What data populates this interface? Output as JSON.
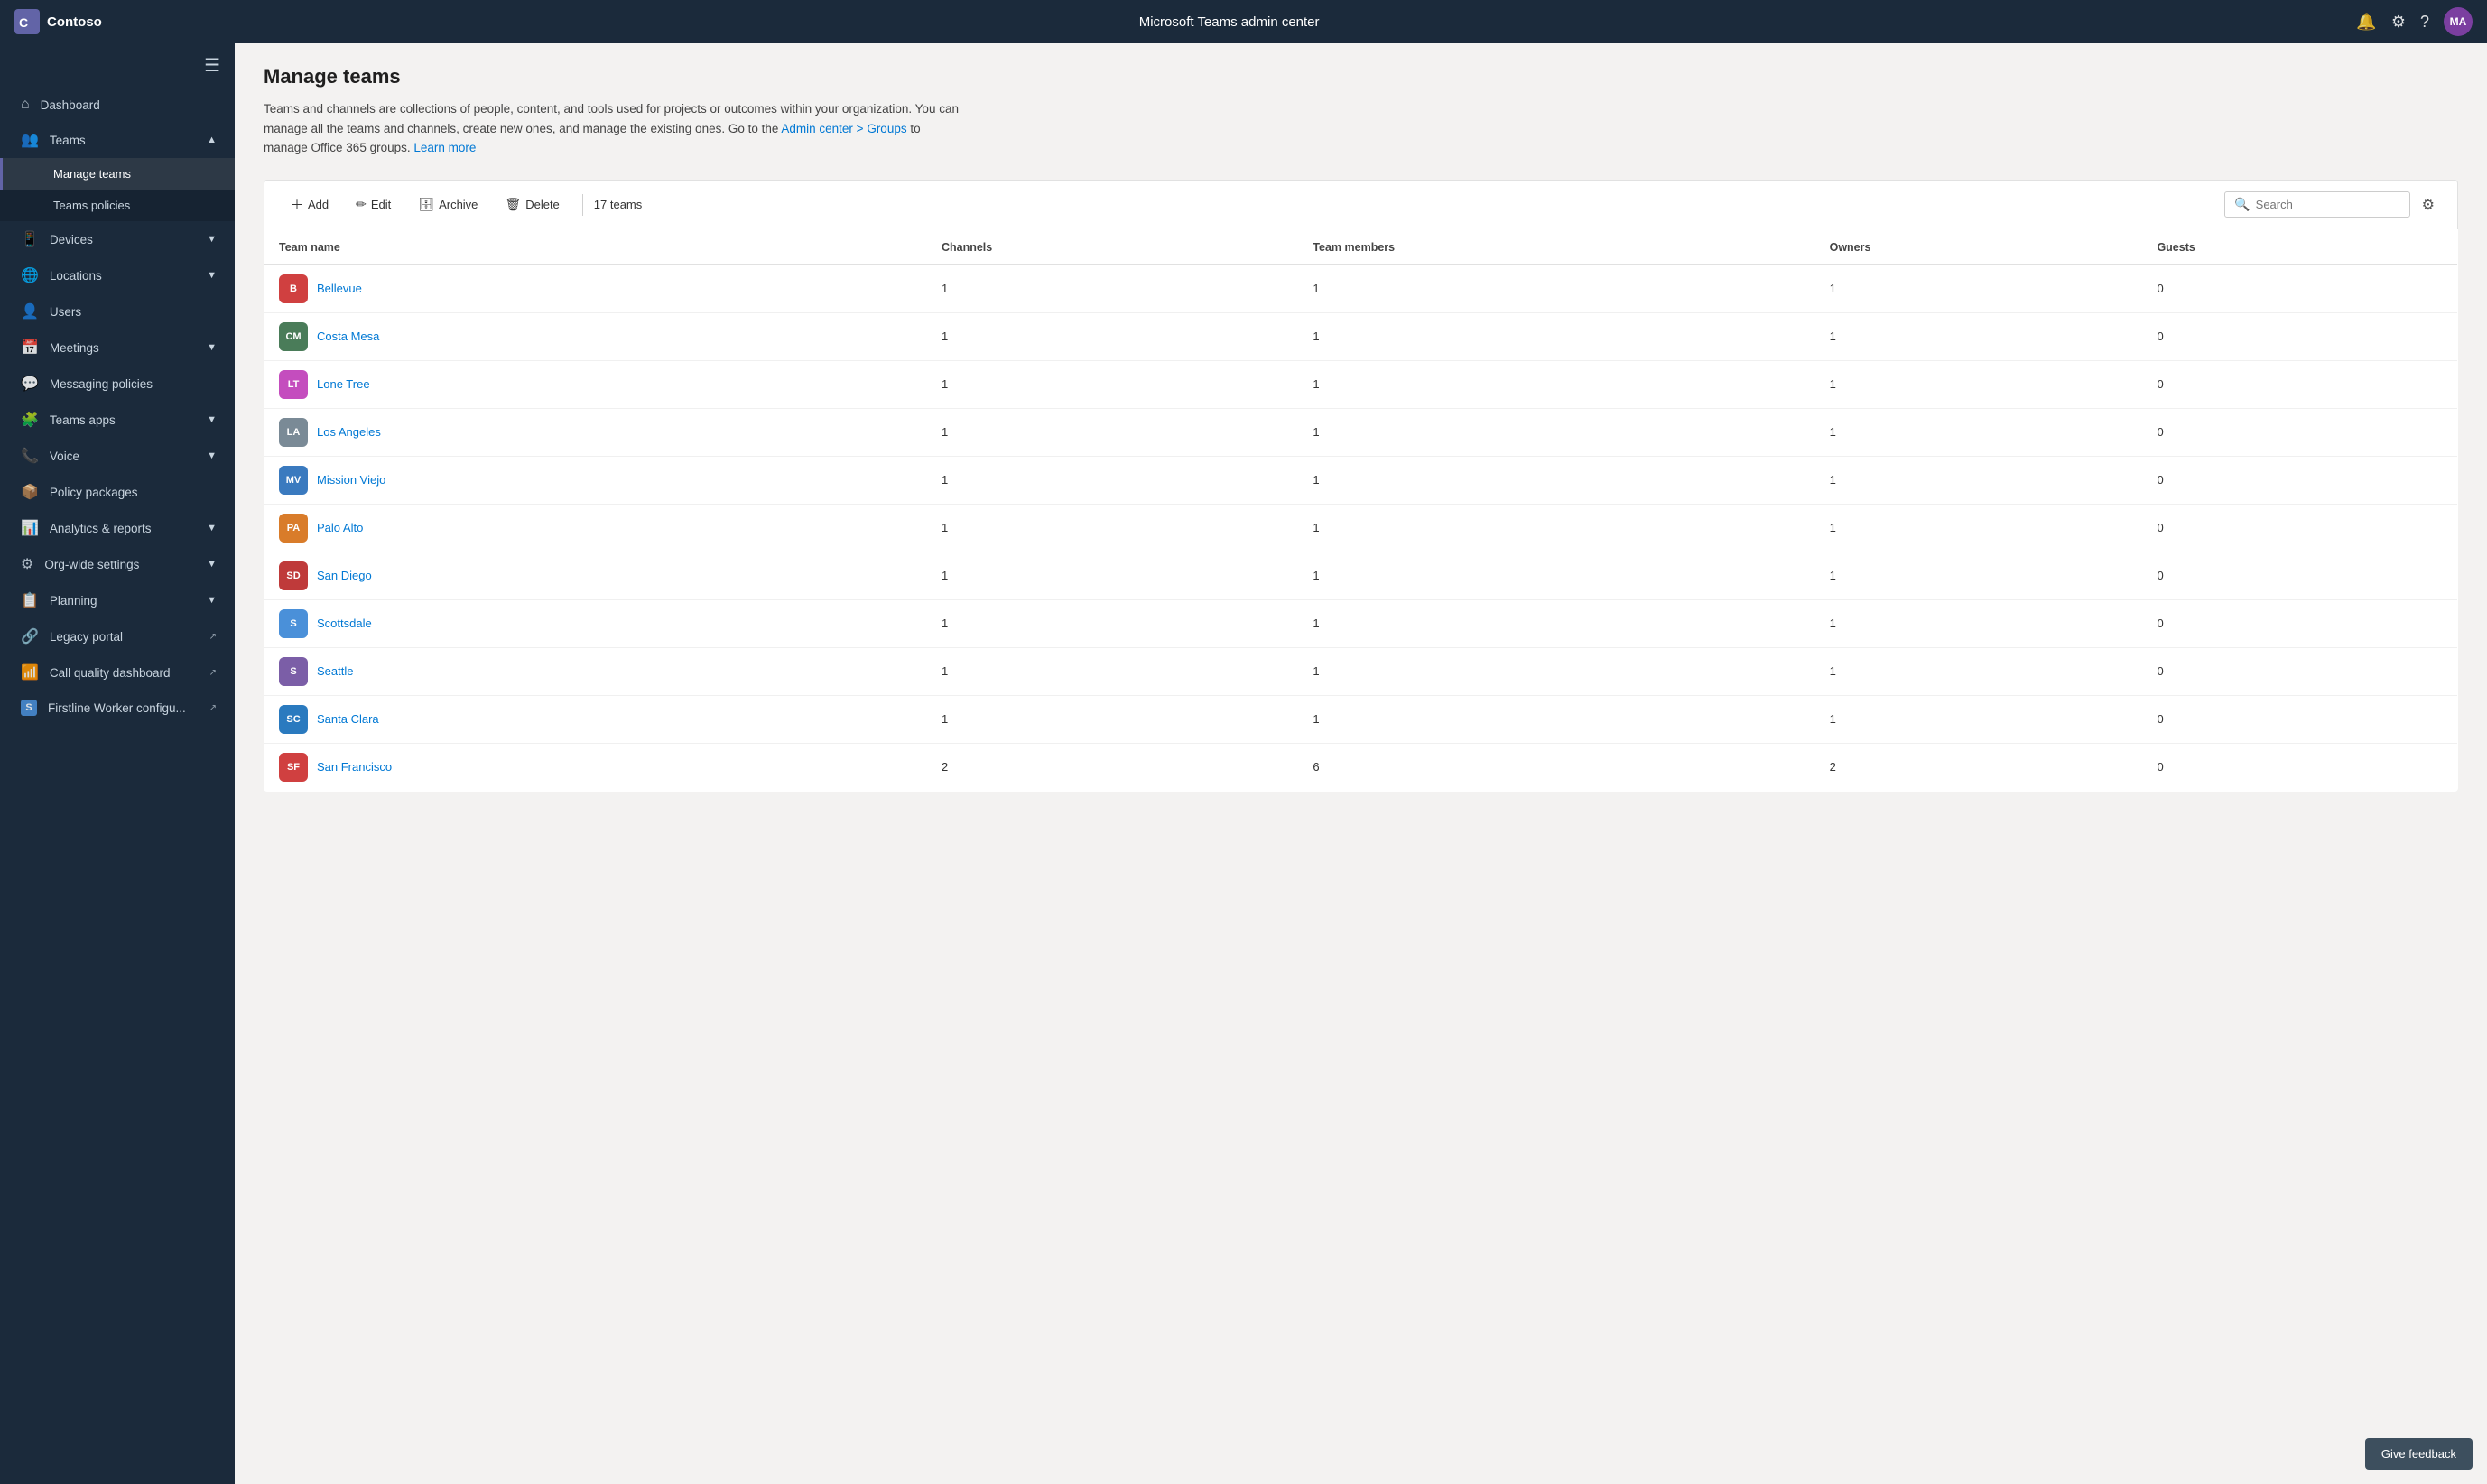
{
  "topbar": {
    "logo_text": "Contoso",
    "title": "Microsoft Teams admin center",
    "avatar_initials": "MA",
    "notification_icon": "🔔",
    "settings_icon": "⚙",
    "help_icon": "?"
  },
  "sidebar": {
    "hamburger": "☰",
    "items": [
      {
        "id": "dashboard",
        "label": "Dashboard",
        "icon": "⌂",
        "hasChildren": false
      },
      {
        "id": "teams",
        "label": "Teams",
        "icon": "👥",
        "hasChildren": true,
        "expanded": true
      },
      {
        "id": "manage-teams",
        "label": "Manage teams",
        "icon": "",
        "isChild": true,
        "active": true
      },
      {
        "id": "teams-policies",
        "label": "Teams policies",
        "icon": "",
        "isChild": true
      },
      {
        "id": "devices",
        "label": "Devices",
        "icon": "📱",
        "hasChildren": true
      },
      {
        "id": "locations",
        "label": "Locations",
        "icon": "🌐",
        "hasChildren": true
      },
      {
        "id": "users",
        "label": "Users",
        "icon": "👤",
        "hasChildren": false
      },
      {
        "id": "meetings",
        "label": "Meetings",
        "icon": "📅",
        "hasChildren": true
      },
      {
        "id": "messaging-policies",
        "label": "Messaging policies",
        "icon": "💬",
        "hasChildren": false
      },
      {
        "id": "teams-apps",
        "label": "Teams apps",
        "icon": "🧩",
        "hasChildren": true
      },
      {
        "id": "voice",
        "label": "Voice",
        "icon": "📞",
        "hasChildren": true
      },
      {
        "id": "policy-packages",
        "label": "Policy packages",
        "icon": "📦",
        "hasChildren": false
      },
      {
        "id": "analytics-reports",
        "label": "Analytics & reports",
        "icon": "📊",
        "hasChildren": true
      },
      {
        "id": "org-wide-settings",
        "label": "Org-wide settings",
        "icon": "⚙",
        "hasChildren": true
      },
      {
        "id": "planning",
        "label": "Planning",
        "icon": "📋",
        "hasChildren": true
      },
      {
        "id": "legacy-portal",
        "label": "Legacy portal",
        "icon": "🔗",
        "hasChildren": false,
        "external": true
      },
      {
        "id": "call-quality",
        "label": "Call quality dashboard",
        "icon": "📶",
        "hasChildren": false,
        "external": true
      },
      {
        "id": "firstline-worker",
        "label": "Firstline Worker configu...",
        "icon": "S",
        "hasChildren": false,
        "external": true
      }
    ]
  },
  "page": {
    "title": "Manage teams",
    "description": "Teams and channels are collections of people, content, and tools used for projects or outcomes within your organization. You can manage all the teams and channels, create new ones, and manage the existing ones. Go to the",
    "link1_text": "Admin center > Groups",
    "description2": "to manage Office 365 groups.",
    "link2_text": "Learn more"
  },
  "toolbar": {
    "add_label": "Add",
    "edit_label": "Edit",
    "archive_label": "Archive",
    "delete_label": "Delete",
    "team_count": "17 teams",
    "search_placeholder": "Search"
  },
  "table": {
    "columns": [
      "Team name",
      "Channels",
      "Team members",
      "Owners",
      "Guests"
    ],
    "rows": [
      {
        "initials": "B",
        "color": "#d04040",
        "name": "Bellevue",
        "channels": 1,
        "members": 1,
        "owners": 1,
        "guests": 0
      },
      {
        "initials": "CM",
        "color": "#4a7c59",
        "name": "Costa Mesa",
        "channels": 1,
        "members": 1,
        "owners": 1,
        "guests": 0
      },
      {
        "initials": "LT",
        "color": "#c44dbe",
        "name": "Lone Tree",
        "channels": 1,
        "members": 1,
        "owners": 1,
        "guests": 0
      },
      {
        "initials": "LA",
        "color": "#7a8a96",
        "name": "Los Angeles",
        "channels": 1,
        "members": 1,
        "owners": 1,
        "guests": 0
      },
      {
        "initials": "MV",
        "color": "#3a7abf",
        "name": "Mission Viejo",
        "channels": 1,
        "members": 1,
        "owners": 1,
        "guests": 0
      },
      {
        "initials": "PA",
        "color": "#d97c2a",
        "name": "Palo Alto",
        "channels": 1,
        "members": 1,
        "owners": 1,
        "guests": 0
      },
      {
        "initials": "SD",
        "color": "#bf3a3a",
        "name": "San Diego",
        "channels": 1,
        "members": 1,
        "owners": 1,
        "guests": 0
      },
      {
        "initials": "S",
        "color": "#4a90d9",
        "name": "Scottsdale",
        "channels": 1,
        "members": 1,
        "owners": 1,
        "guests": 0
      },
      {
        "initials": "S",
        "color": "#7b5ea7",
        "name": "Seattle",
        "channels": 1,
        "members": 1,
        "owners": 1,
        "guests": 0
      },
      {
        "initials": "SC",
        "color": "#2a7abf",
        "name": "Santa Clara",
        "channels": 1,
        "members": 1,
        "owners": 1,
        "guests": 0
      },
      {
        "initials": "SF",
        "color": "#d04040",
        "name": "San Francisco",
        "channels": 2,
        "members": 6,
        "owners": 2,
        "guests": 0
      }
    ]
  },
  "feedback": {
    "label": "Give feedback"
  }
}
